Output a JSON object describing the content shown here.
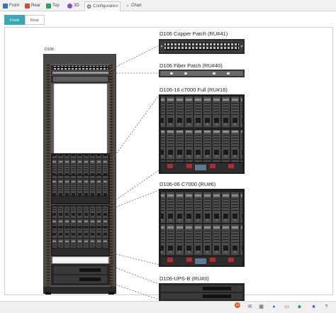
{
  "tabs": [
    {
      "label": "Front",
      "icon": "front-view-icon",
      "color": "#3b6fc4"
    },
    {
      "label": "Rear",
      "icon": "rear-view-icon",
      "color": "#d84b3c"
    },
    {
      "label": "Top",
      "icon": "top-view-icon",
      "color": "#2f9e57"
    },
    {
      "label": "3D",
      "icon": "cube-3d-icon",
      "color": "#8b4ab8"
    },
    {
      "label": "Configuration",
      "icon": "gear-icon",
      "color": "#666666"
    },
    {
      "label": "Chart",
      "icon": "chart-icon",
      "color": "#888888"
    }
  ],
  "active_tab": "Configuration",
  "subtabs": [
    "Front",
    "Rear"
  ],
  "active_subtab": "Front",
  "rack": {
    "label": "D106"
  },
  "devices": [
    {
      "label": "D106 Copper Patch (RU#41)"
    },
    {
      "label": "D106 Fiber Patch (RU#40)"
    },
    {
      "label": "D106-16 c7000 Full (RU#16)"
    },
    {
      "label": "D106-06 C7000 (RU#6)"
    },
    {
      "label": "D106-UPS-B (RU#3)"
    }
  ],
  "status": {
    "notification_count": "13"
  }
}
